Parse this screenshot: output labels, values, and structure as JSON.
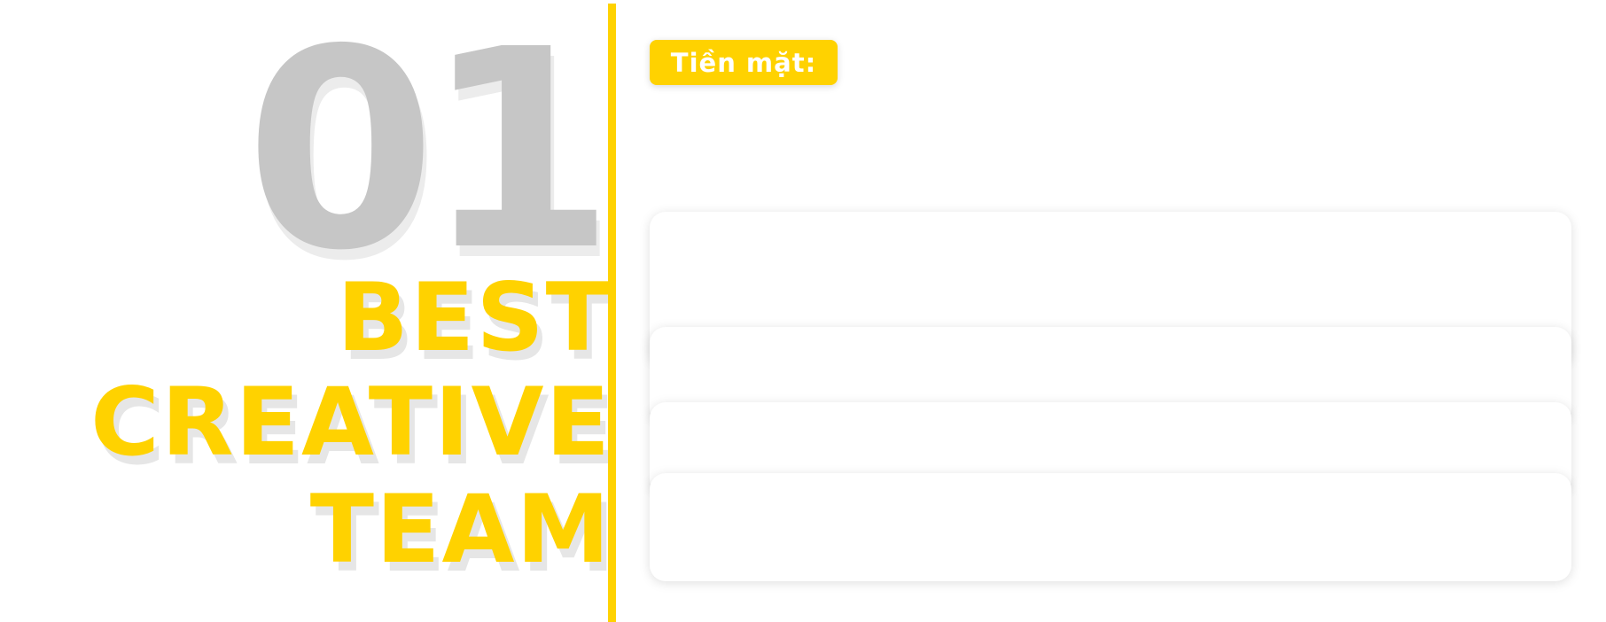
{
  "hero": {
    "number": "01",
    "line1": "BEST",
    "line2": "CREATIVE",
    "line3": "TEAM"
  },
  "panel": {
    "label": "Tiền mặt:"
  },
  "colors": {
    "accent": "#ffd200",
    "number_gray": "#c6c6c6",
    "background": "#ffffff"
  }
}
